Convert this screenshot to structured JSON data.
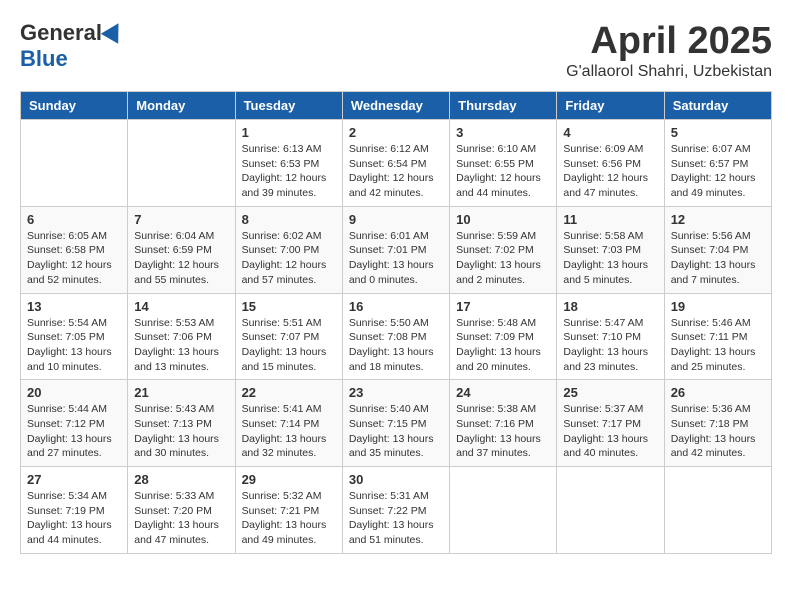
{
  "header": {
    "logo_general": "General",
    "logo_blue": "Blue",
    "month_title": "April 2025",
    "location": "G'allaorol Shahri, Uzbekistan"
  },
  "weekdays": [
    "Sunday",
    "Monday",
    "Tuesday",
    "Wednesday",
    "Thursday",
    "Friday",
    "Saturday"
  ],
  "weeks": [
    [
      {
        "day": "",
        "empty": true
      },
      {
        "day": "",
        "empty": true
      },
      {
        "day": "1",
        "sunrise": "Sunrise: 6:13 AM",
        "sunset": "Sunset: 6:53 PM",
        "daylight": "Daylight: 12 hours and 39 minutes."
      },
      {
        "day": "2",
        "sunrise": "Sunrise: 6:12 AM",
        "sunset": "Sunset: 6:54 PM",
        "daylight": "Daylight: 12 hours and 42 minutes."
      },
      {
        "day": "3",
        "sunrise": "Sunrise: 6:10 AM",
        "sunset": "Sunset: 6:55 PM",
        "daylight": "Daylight: 12 hours and 44 minutes."
      },
      {
        "day": "4",
        "sunrise": "Sunrise: 6:09 AM",
        "sunset": "Sunset: 6:56 PM",
        "daylight": "Daylight: 12 hours and 47 minutes."
      },
      {
        "day": "5",
        "sunrise": "Sunrise: 6:07 AM",
        "sunset": "Sunset: 6:57 PM",
        "daylight": "Daylight: 12 hours and 49 minutes."
      }
    ],
    [
      {
        "day": "6",
        "sunrise": "Sunrise: 6:05 AM",
        "sunset": "Sunset: 6:58 PM",
        "daylight": "Daylight: 12 hours and 52 minutes."
      },
      {
        "day": "7",
        "sunrise": "Sunrise: 6:04 AM",
        "sunset": "Sunset: 6:59 PM",
        "daylight": "Daylight: 12 hours and 55 minutes."
      },
      {
        "day": "8",
        "sunrise": "Sunrise: 6:02 AM",
        "sunset": "Sunset: 7:00 PM",
        "daylight": "Daylight: 12 hours and 57 minutes."
      },
      {
        "day": "9",
        "sunrise": "Sunrise: 6:01 AM",
        "sunset": "Sunset: 7:01 PM",
        "daylight": "Daylight: 13 hours and 0 minutes."
      },
      {
        "day": "10",
        "sunrise": "Sunrise: 5:59 AM",
        "sunset": "Sunset: 7:02 PM",
        "daylight": "Daylight: 13 hours and 2 minutes."
      },
      {
        "day": "11",
        "sunrise": "Sunrise: 5:58 AM",
        "sunset": "Sunset: 7:03 PM",
        "daylight": "Daylight: 13 hours and 5 minutes."
      },
      {
        "day": "12",
        "sunrise": "Sunrise: 5:56 AM",
        "sunset": "Sunset: 7:04 PM",
        "daylight": "Daylight: 13 hours and 7 minutes."
      }
    ],
    [
      {
        "day": "13",
        "sunrise": "Sunrise: 5:54 AM",
        "sunset": "Sunset: 7:05 PM",
        "daylight": "Daylight: 13 hours and 10 minutes."
      },
      {
        "day": "14",
        "sunrise": "Sunrise: 5:53 AM",
        "sunset": "Sunset: 7:06 PM",
        "daylight": "Daylight: 13 hours and 13 minutes."
      },
      {
        "day": "15",
        "sunrise": "Sunrise: 5:51 AM",
        "sunset": "Sunset: 7:07 PM",
        "daylight": "Daylight: 13 hours and 15 minutes."
      },
      {
        "day": "16",
        "sunrise": "Sunrise: 5:50 AM",
        "sunset": "Sunset: 7:08 PM",
        "daylight": "Daylight: 13 hours and 18 minutes."
      },
      {
        "day": "17",
        "sunrise": "Sunrise: 5:48 AM",
        "sunset": "Sunset: 7:09 PM",
        "daylight": "Daylight: 13 hours and 20 minutes."
      },
      {
        "day": "18",
        "sunrise": "Sunrise: 5:47 AM",
        "sunset": "Sunset: 7:10 PM",
        "daylight": "Daylight: 13 hours and 23 minutes."
      },
      {
        "day": "19",
        "sunrise": "Sunrise: 5:46 AM",
        "sunset": "Sunset: 7:11 PM",
        "daylight": "Daylight: 13 hours and 25 minutes."
      }
    ],
    [
      {
        "day": "20",
        "sunrise": "Sunrise: 5:44 AM",
        "sunset": "Sunset: 7:12 PM",
        "daylight": "Daylight: 13 hours and 27 minutes."
      },
      {
        "day": "21",
        "sunrise": "Sunrise: 5:43 AM",
        "sunset": "Sunset: 7:13 PM",
        "daylight": "Daylight: 13 hours and 30 minutes."
      },
      {
        "day": "22",
        "sunrise": "Sunrise: 5:41 AM",
        "sunset": "Sunset: 7:14 PM",
        "daylight": "Daylight: 13 hours and 32 minutes."
      },
      {
        "day": "23",
        "sunrise": "Sunrise: 5:40 AM",
        "sunset": "Sunset: 7:15 PM",
        "daylight": "Daylight: 13 hours and 35 minutes."
      },
      {
        "day": "24",
        "sunrise": "Sunrise: 5:38 AM",
        "sunset": "Sunset: 7:16 PM",
        "daylight": "Daylight: 13 hours and 37 minutes."
      },
      {
        "day": "25",
        "sunrise": "Sunrise: 5:37 AM",
        "sunset": "Sunset: 7:17 PM",
        "daylight": "Daylight: 13 hours and 40 minutes."
      },
      {
        "day": "26",
        "sunrise": "Sunrise: 5:36 AM",
        "sunset": "Sunset: 7:18 PM",
        "daylight": "Daylight: 13 hours and 42 minutes."
      }
    ],
    [
      {
        "day": "27",
        "sunrise": "Sunrise: 5:34 AM",
        "sunset": "Sunset: 7:19 PM",
        "daylight": "Daylight: 13 hours and 44 minutes."
      },
      {
        "day": "28",
        "sunrise": "Sunrise: 5:33 AM",
        "sunset": "Sunset: 7:20 PM",
        "daylight": "Daylight: 13 hours and 47 minutes."
      },
      {
        "day": "29",
        "sunrise": "Sunrise: 5:32 AM",
        "sunset": "Sunset: 7:21 PM",
        "daylight": "Daylight: 13 hours and 49 minutes."
      },
      {
        "day": "30",
        "sunrise": "Sunrise: 5:31 AM",
        "sunset": "Sunset: 7:22 PM",
        "daylight": "Daylight: 13 hours and 51 minutes."
      },
      {
        "day": "",
        "empty": true
      },
      {
        "day": "",
        "empty": true
      },
      {
        "day": "",
        "empty": true
      }
    ]
  ]
}
